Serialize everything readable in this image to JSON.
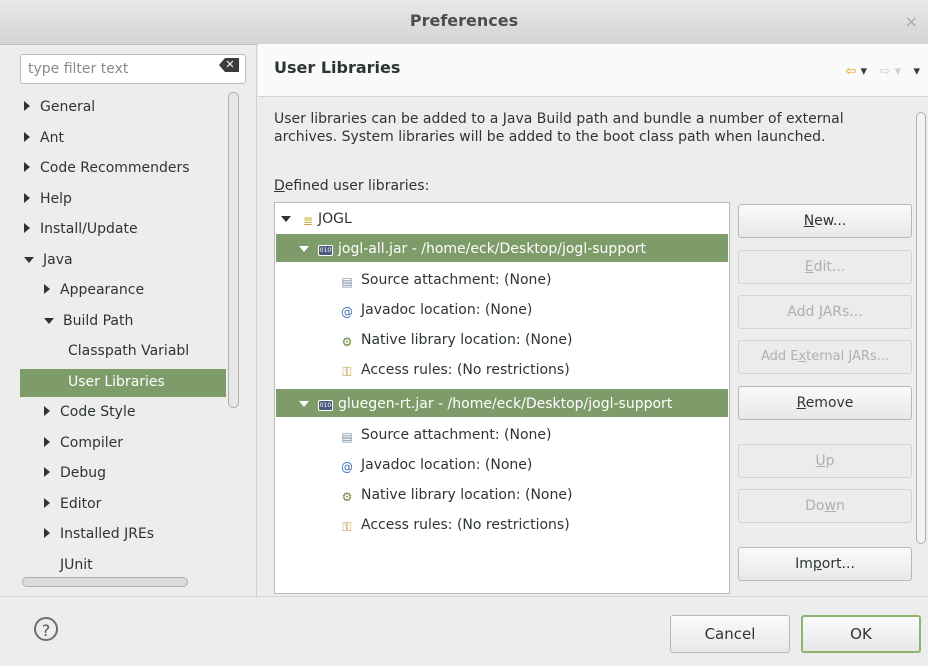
{
  "window": {
    "title": "Preferences",
    "close_glyph": "×"
  },
  "filter": {
    "placeholder": "type filter text"
  },
  "tree": [
    {
      "label": "General",
      "expander": "collapsed",
      "level": 0
    },
    {
      "label": "Ant",
      "expander": "collapsed",
      "level": 0
    },
    {
      "label": "Code Recommenders",
      "expander": "collapsed",
      "level": 0
    },
    {
      "label": "Help",
      "expander": "collapsed",
      "level": 0
    },
    {
      "label": "Install/Update",
      "expander": "collapsed",
      "level": 0
    },
    {
      "label": "Java",
      "expander": "expanded",
      "level": 0
    },
    {
      "label": "Appearance",
      "expander": "collapsed",
      "level": 1
    },
    {
      "label": "Build Path",
      "expander": "expanded",
      "level": 1
    },
    {
      "label": "Classpath Variabl",
      "expander": "none",
      "level": 2
    },
    {
      "label": "User Libraries",
      "expander": "none",
      "level": 2,
      "selected": true
    },
    {
      "label": "Code Style",
      "expander": "collapsed",
      "level": 1
    },
    {
      "label": "Compiler",
      "expander": "collapsed",
      "level": 1
    },
    {
      "label": "Debug",
      "expander": "collapsed",
      "level": 1
    },
    {
      "label": "Editor",
      "expander": "collapsed",
      "level": 1
    },
    {
      "label": "Installed JREs",
      "expander": "collapsed",
      "level": 1
    },
    {
      "label": "JUnit",
      "expander": "none",
      "level": 1
    }
  ],
  "page": {
    "title": "User Libraries",
    "description": "User libraries can be added to a Java Build path and bundle a number of external archives. System libraries will be added to the boot class path when launched.",
    "defined_label_prefix": "D",
    "defined_label_rest": "efined user libraries:"
  },
  "libraries": {
    "library_name": "JOGL",
    "jars": [
      {
        "label": "jogl-all.jar - /home/eck/Desktop/jogl-support",
        "children": [
          {
            "icon": "source-attachment-icon",
            "label": "Source attachment: (None)"
          },
          {
            "icon": "javadoc-icon",
            "label": "Javadoc location: (None)"
          },
          {
            "icon": "native-library-icon",
            "label": "Native library location: (None)"
          },
          {
            "icon": "access-rules-icon",
            "label": "Access rules: (No restrictions)"
          }
        ]
      },
      {
        "label": "gluegen-rt.jar - /home/eck/Desktop/jogl-support",
        "children": [
          {
            "icon": "source-attachment-icon",
            "label": "Source attachment: (None)"
          },
          {
            "icon": "javadoc-icon",
            "label": "Javadoc location: (None)"
          },
          {
            "icon": "native-library-icon",
            "label": "Native library location: (None)"
          },
          {
            "icon": "access-rules-icon",
            "label": "Access rules: (No restrictions)"
          }
        ]
      }
    ]
  },
  "buttons": {
    "new": {
      "u": "N",
      "rest": "ew...",
      "enabled": true
    },
    "edit": {
      "u": "E",
      "rest": "dit...",
      "enabled": false
    },
    "add_jars": {
      "label": "Add JARs...",
      "enabled": false
    },
    "add_external_pre": "Add E",
    "add_external_u": "x",
    "add_external_post": "ternal JARs...",
    "remove": {
      "u": "R",
      "rest": "emove",
      "enabled": true
    },
    "up": {
      "u": "U",
      "rest": "p",
      "enabled": false
    },
    "down_pre": "Do",
    "down_u": "w",
    "down_post": "n",
    "import_pre": "Im",
    "import_u": "p",
    "import_post": "ort..."
  },
  "footer": {
    "help_glyph": "?",
    "cancel_label": "Cancel",
    "ok_label": "OK"
  },
  "colors": {
    "selection": "#7d9c6a",
    "ok_border": "#8db36e",
    "back_arrow": "#e6a31a"
  }
}
